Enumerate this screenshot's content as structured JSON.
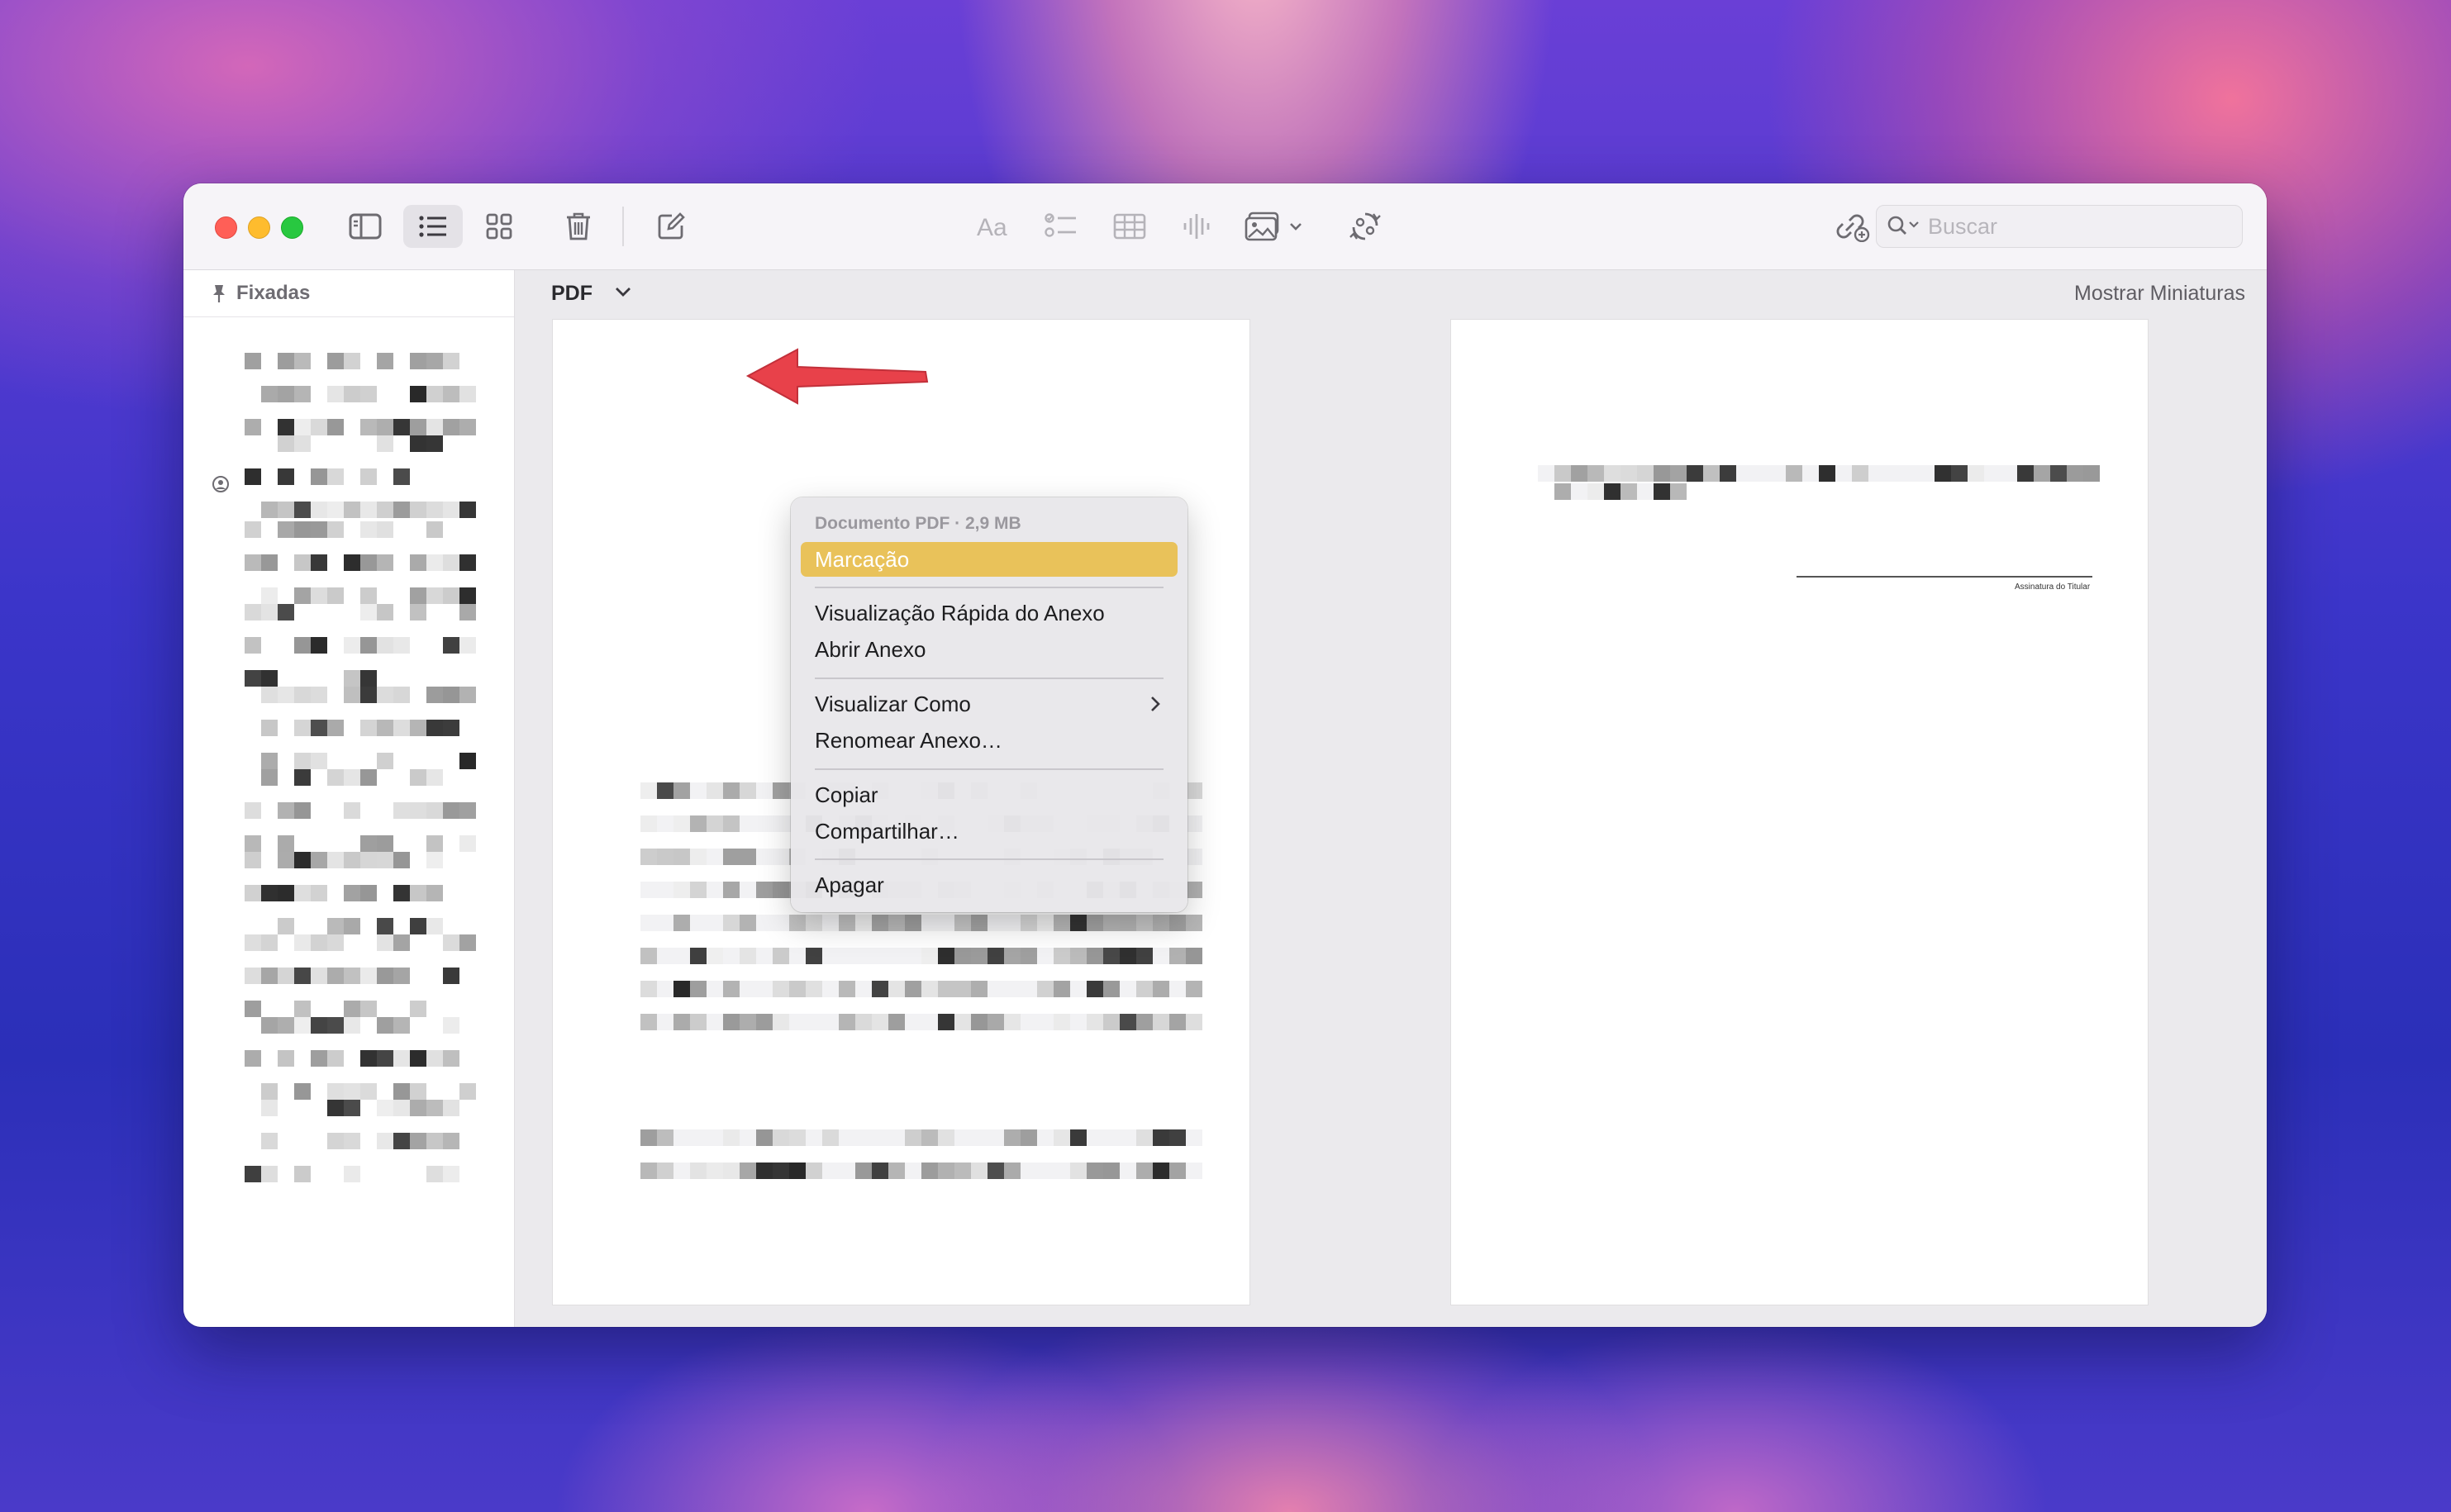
{
  "window": {
    "toolbar": {
      "search_placeholder": "Buscar",
      "icons": [
        "sidebar-toggle-icon",
        "list-view-icon",
        "gallery-view-icon",
        "trash-icon",
        "compose-icon",
        "format-text-icon",
        "checklist-icon",
        "table-icon",
        "audio-waveform-icon",
        "media-icon",
        "chevron-down-icon",
        "collaborate-icon",
        "add-link-icon",
        "lock-icon",
        "share-icon",
        "search-icon"
      ]
    },
    "sidebar": {
      "pinned_label": "Fixadas"
    },
    "attachment": {
      "type_label": "PDF",
      "show_thumbnails": "Mostrar Miniaturas",
      "signature_label": "Assinatura do Titular"
    },
    "context_menu": {
      "header": "Documento PDF · 2,9 MB",
      "items": [
        {
          "label": "Marcação",
          "highlighted": true
        },
        {
          "label": "Visualização Rápida do Anexo"
        },
        {
          "label": "Abrir Anexo"
        },
        {
          "label": "Visualizar Como",
          "has_submenu": true
        },
        {
          "label": "Renomear Anexo…"
        },
        {
          "label": "Copiar"
        },
        {
          "label": "Compartilhar…"
        },
        {
          "label": "Apagar"
        }
      ]
    }
  },
  "colors": {
    "menu_highlight": "#e9c25a",
    "annotation_arrow": "#e8414a",
    "traffic_red": "#ff5f57",
    "traffic_yellow": "#febc2e",
    "traffic_green": "#28c840"
  }
}
